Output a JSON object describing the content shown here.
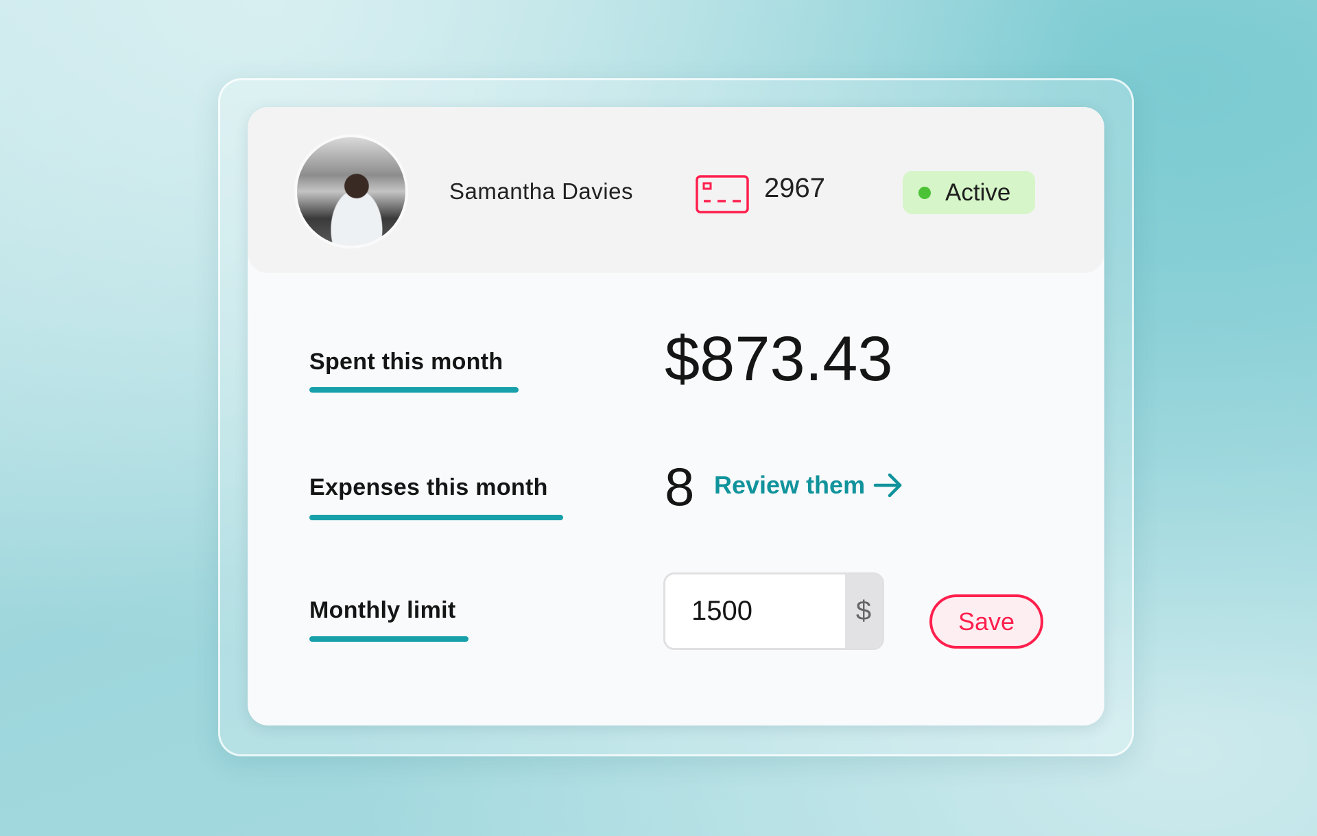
{
  "user": {
    "name": "Samantha Davies",
    "card_last4": "2967",
    "status": "Active"
  },
  "rows": {
    "spent": {
      "label": "Spent this month",
      "value": "$873.43"
    },
    "expenses": {
      "label": "Expenses this month",
      "value": "8",
      "link": "Review them"
    },
    "limit": {
      "label": "Monthly limit",
      "value": "1500",
      "currency": "$",
      "save_label": "Save"
    }
  },
  "colors": {
    "accent": "#18a0aa",
    "link": "#11939c",
    "danger": "#ff1f4d",
    "active_bg": "#d6f5c8",
    "active_dot": "#4cc236"
  },
  "icons": {
    "card": "credit-card-icon",
    "arrow": "arrow-right-icon",
    "status": "status-dot-icon"
  }
}
